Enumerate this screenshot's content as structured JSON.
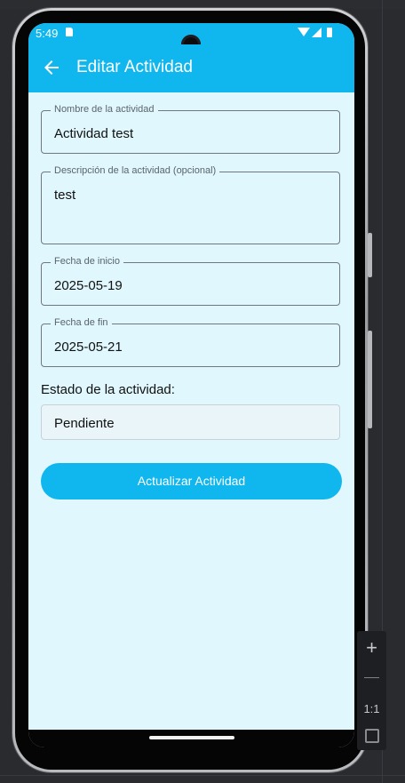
{
  "status_bar": {
    "time": "5:49",
    "icons": [
      "sd-card-icon",
      "camera-cutout",
      "wifi-icon",
      "signal-icon",
      "battery-icon"
    ]
  },
  "app_bar": {
    "title": "Editar Actividad",
    "back_icon": "arrow-left-icon",
    "background": "#0fb7ee"
  },
  "form": {
    "name_field": {
      "label": "Nombre de la actividad",
      "value": "Actividad test"
    },
    "description_field": {
      "label": "Descripción de la actividad (opcional)",
      "value": "test"
    },
    "start_date_field": {
      "label": "Fecha de inicio",
      "value": "2025-05-19"
    },
    "end_date_field": {
      "label": "Fecha de fin",
      "value": "2025-05-21"
    },
    "status_label": "Estado de la actividad:",
    "status_select": {
      "value": "Pendiente"
    },
    "submit_button": "Actualizar Actividad"
  },
  "emulator_toolbar": {
    "zoom_in": "+",
    "zoom_out": "—",
    "ratio": "1:1",
    "fit_icon": "fit-screen-icon"
  },
  "colors": {
    "accent": "#0fb7ee",
    "screen_background": "#dff7fd",
    "field_border": "#6f7880"
  }
}
